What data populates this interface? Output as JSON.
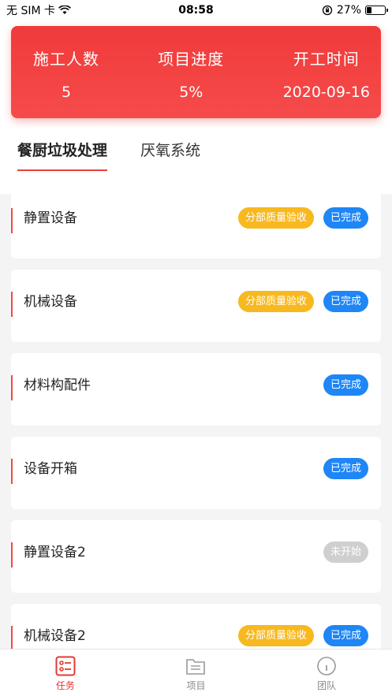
{
  "status_bar": {
    "carrier": "无 SIM 卡",
    "time": "08:58",
    "battery": "27%",
    "battery_level": 0.27
  },
  "stats": [
    {
      "label": "施工人数",
      "value": "5"
    },
    {
      "label": "项目进度",
      "value": "5%"
    },
    {
      "label": "开工时间",
      "value": "2020-09-16"
    }
  ],
  "tabs": [
    {
      "label": "餐厨垃圾处理",
      "active": true
    },
    {
      "label": "厌氧系统",
      "active": false
    }
  ],
  "items": [
    {
      "title": "静置设备",
      "tags": [
        "分部质量验收",
        "已完成"
      ]
    },
    {
      "title": "机械设备",
      "tags": [
        "分部质量验收",
        "已完成"
      ]
    },
    {
      "title": "材料构配件",
      "tags": [
        "已完成"
      ]
    },
    {
      "title": "设备开箱",
      "tags": [
        "已完成"
      ]
    },
    {
      "title": "静置设备2",
      "tags": [
        "未开始"
      ]
    },
    {
      "title": "机械设备2",
      "tags": [
        "分部质量验收",
        "已完成"
      ]
    }
  ],
  "bottom_nav": [
    {
      "label": "任务",
      "icon": "task-icon",
      "active": true
    },
    {
      "label": "项目",
      "icon": "folder-icon",
      "active": false
    },
    {
      "label": "团队",
      "icon": "team-icon",
      "active": false
    }
  ],
  "colors": {
    "accent": "#e23a31",
    "quality_tag": "#f8b81f",
    "done_tag": "#1e86f6",
    "pending_tag": "#cfcfcf"
  }
}
